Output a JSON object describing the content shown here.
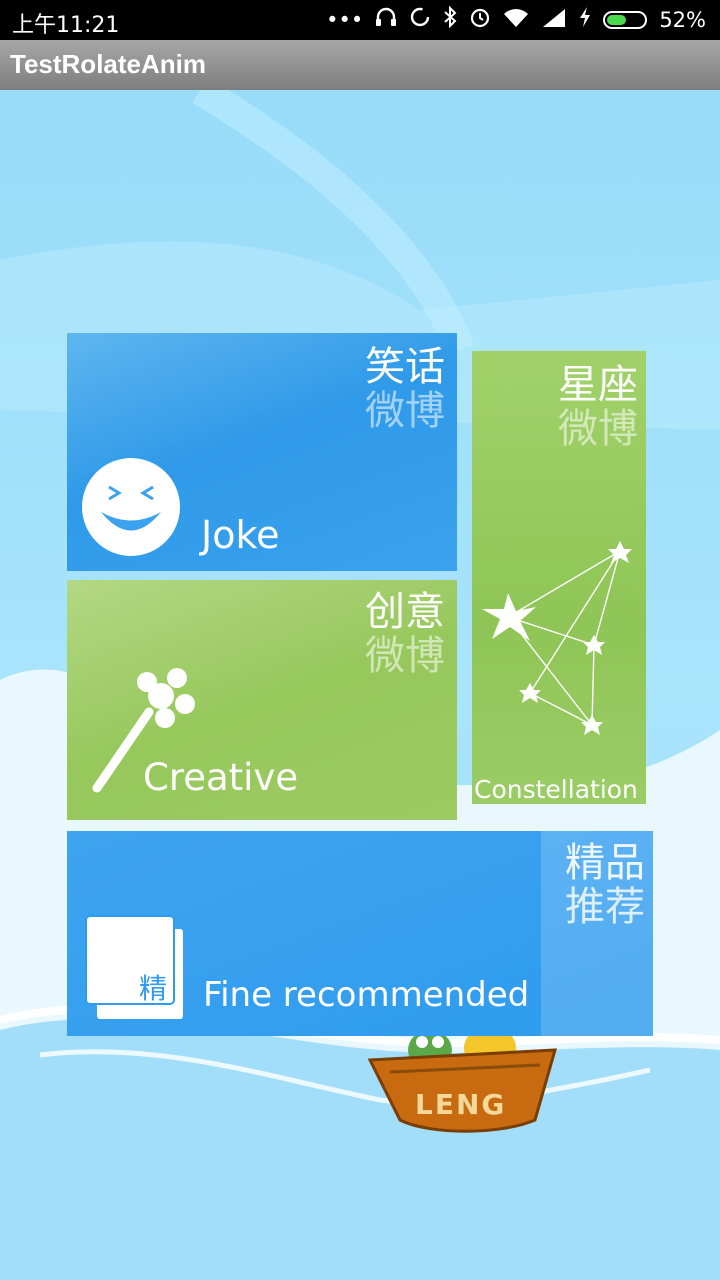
{
  "status_bar": {
    "time": "上午11:21",
    "battery_percent": "52%",
    "battery_level": 0.52,
    "icons": [
      "more-dots-icon",
      "headset-icon",
      "sync-icon",
      "bluetooth-icon",
      "alarm-icon",
      "wifi-icon",
      "signal-icon",
      "charging-icon",
      "battery-icon"
    ]
  },
  "app": {
    "title": "TestRolateAnim"
  },
  "tiles": {
    "joke": {
      "cn_line1": "笑话",
      "cn_line2": "微博",
      "en": "Joke",
      "color": "#3aa2ee"
    },
    "creative": {
      "cn_line1": "创意",
      "cn_line2": "微博",
      "en": "Creative",
      "color": "#9ccb62"
    },
    "constellation": {
      "cn_line1": "星座",
      "cn_line2": "微博",
      "en": "Constellation",
      "color": "#9bcc66"
    },
    "fine": {
      "cn_line1": "精品",
      "cn_line2": "推荐",
      "en": "Fine recommended",
      "badge": "精",
      "color": "#2e9bee"
    }
  },
  "boat": {
    "label": "LENG"
  }
}
